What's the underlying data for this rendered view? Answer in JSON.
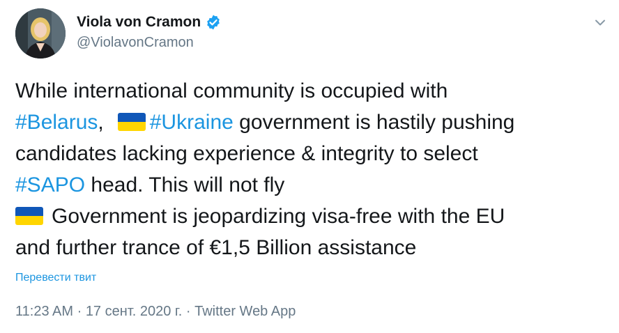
{
  "author": {
    "display_name": "Viola von Cramon",
    "handle": "@ViolavonCramon",
    "avatar_icon": "profile-photo",
    "verified_icon": "verified-badge-icon"
  },
  "menu_icon": "chevron-down-icon",
  "tweet": {
    "line1": "While international community is occupied with",
    "hashtag_belarus": "#Belarus",
    "comma": ",",
    "hashtag_ukraine": "#Ukraine",
    "line2_rest": " government is hastily pushing",
    "line3": "candidates lacking experience & integrity to select",
    "hashtag_sapo": "#SAPO",
    "line4_rest": " head. This will not fly",
    "line5_rest": "Government is jeopardizing visa-free with the EU",
    "line6": "and further trance of €1,5 Billion assistance",
    "flag_icon": "ukraine-flag-icon"
  },
  "translate_label": "Перевести твит",
  "meta": {
    "time": "11:23 AM",
    "separator": " · ",
    "date": "17 сент. 2020 г.",
    "source": "Twitter Web App"
  },
  "colors": {
    "link": "#1b95e0",
    "secondary": "#657786",
    "text": "#14171a",
    "flag_blue": "#1057b8",
    "flag_yellow": "#ffd500"
  }
}
